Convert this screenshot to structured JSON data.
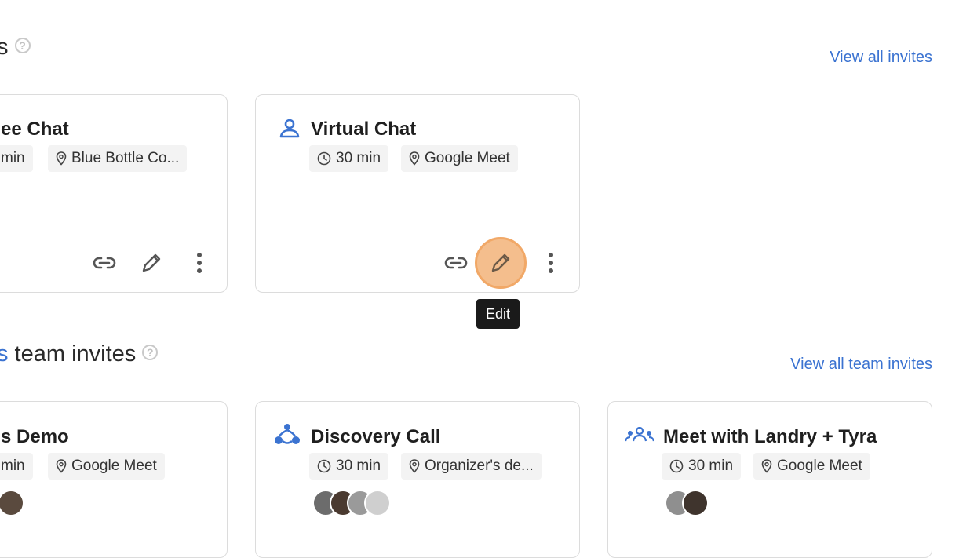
{
  "section1": {
    "title_visible": "s",
    "view_all": "View all invites"
  },
  "section2": {
    "title_accent": "s",
    "title_rest": " team invites",
    "view_all": "View all team invites"
  },
  "cards": [
    {
      "title": "ee Chat",
      "duration": "min",
      "location": "Blue Bottle Co..."
    },
    {
      "title": "Virtual Chat",
      "duration": "30 min",
      "location": "Google Meet"
    },
    {
      "title": "s Demo",
      "duration": "min",
      "location": "Google Meet"
    },
    {
      "title": "Discovery Call",
      "duration": "30 min",
      "location": "Organizer's de..."
    },
    {
      "title": "Meet with Landry + Tyra",
      "duration": "30 min",
      "location": "Google Meet"
    }
  ],
  "tooltip": {
    "text": "Edit"
  },
  "icons": {
    "person": "person-icon",
    "team_logo": "team-logo-icon",
    "group": "group-icon",
    "clock": "clock-icon",
    "location": "location-pin-icon",
    "link": "link-icon",
    "edit": "pencil-icon",
    "more": "more-vertical-icon"
  },
  "colors": {
    "accent": "#3b73d1",
    "hover_ring": "#f1a867",
    "tooltip_bg": "#1a1a1a"
  }
}
